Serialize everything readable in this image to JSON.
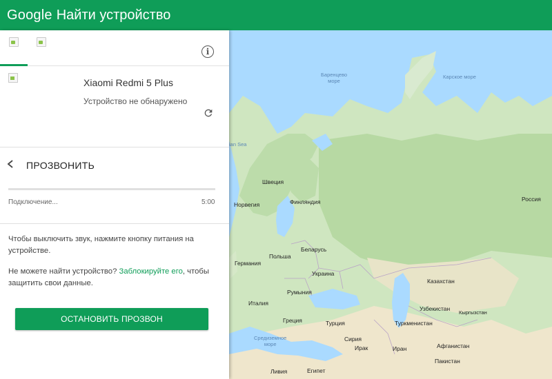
{
  "header": {
    "brand": "Google",
    "title": "Найти устройство",
    "color": "#0f9d58"
  },
  "device_tabs": [
    {
      "icon": "device-image-icon",
      "active": true
    },
    {
      "icon": "device-image-icon",
      "active": false
    }
  ],
  "device": {
    "name": "Xiaomi Redmi 5 Plus",
    "status": "Устройство не обнаружено"
  },
  "ring": {
    "title": "ПРОЗВОНИТЬ",
    "progress_label": "Подключение...",
    "time": "5:00",
    "progress": 0
  },
  "hints": {
    "mute": "Чтобы выключить звук, нажмите кнопку питания на устройстве.",
    "cant_find_prefix": "Не можете найти устройство? ",
    "lock_link": "Заблокируйте его",
    "cant_find_suffix": ", чтобы защитить свои данные."
  },
  "stop_button": "ОСТАНОВИТЬ ПРОЗВОН",
  "map": {
    "seas": {
      "barents": "Баренцево\nморе",
      "kara": "Карское море",
      "norwegian": "ian Sea",
      "mediterranean": "Средиземное\nморе"
    },
    "countries": {
      "sweden": "Швеция",
      "finland": "Финляндия",
      "norway": "Норвегия",
      "russia": "Россия",
      "belarus": "Беларусь",
      "poland": "Польша",
      "germany": "Германия",
      "ukraine": "Украина",
      "kazakhstan": "Казахстан",
      "romania": "Румыния",
      "italy": "Италия",
      "uzbekistan": "Узбекистан",
      "kyrgyzstan": "Кыргызстан",
      "turkmenistan": "Туркменистан",
      "greece": "Греция",
      "turkey": "Турция",
      "syria": "Сирия",
      "iraq": "Ирак",
      "iran": "Иран",
      "afghanistan": "Афганистан",
      "pakistan": "Пакистан",
      "libya": "Ливия",
      "egypt": "Египет"
    }
  }
}
